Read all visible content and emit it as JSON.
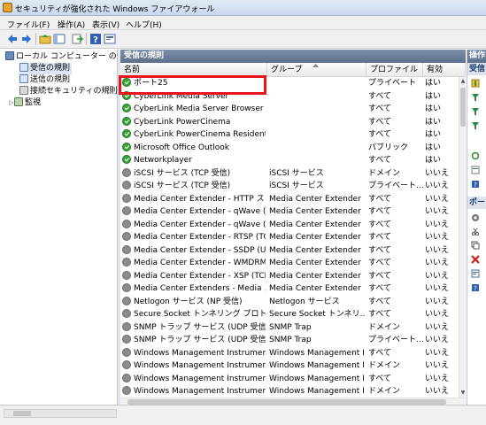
{
  "window": {
    "title": "セキュリティが強化された Windows ファイアウォール"
  },
  "menu": [
    "ファイル(F)",
    "操作(A)",
    "表示(V)",
    "ヘルプ(H)"
  ],
  "toolbar": {
    "icons": [
      "back-icon",
      "forward-icon",
      "up-folder-icon",
      "show-hide-tree-icon",
      "export-icon",
      "help-icon",
      "properties-icon"
    ]
  },
  "tree": {
    "root": "ローカル コンピューター のセ",
    "items": [
      "受信の規則",
      "送信の規則",
      "接続セキュリティの規則",
      "監視"
    ]
  },
  "main": {
    "title": "受信の規則",
    "columns": [
      "名前",
      "グループ",
      "プロファイル",
      "有効"
    ],
    "rows": [
      {
        "name": "ポート25",
        "group": "",
        "profile": "プライベート",
        "enabled": "はい",
        "status": "on"
      },
      {
        "name": "CyberLink Media Server",
        "group": "",
        "profile": "すべて",
        "enabled": "はい",
        "status": "on"
      },
      {
        "name": "CyberLink Media Server Browser Eng...",
        "group": "",
        "profile": "すべて",
        "enabled": "はい",
        "status": "on"
      },
      {
        "name": "CyberLink PowerCinema",
        "group": "",
        "profile": "すべて",
        "enabled": "はい",
        "status": "on"
      },
      {
        "name": "CyberLink PowerCinema Resident Pr...",
        "group": "",
        "profile": "すべて",
        "enabled": "はい",
        "status": "on"
      },
      {
        "name": "Microsoft Office Outlook",
        "group": "",
        "profile": "パブリック",
        "enabled": "はい",
        "status": "on"
      },
      {
        "name": "Networkplayer",
        "group": "",
        "profile": "すべて",
        "enabled": "はい",
        "status": "on"
      },
      {
        "name": "iSCSI サービス (TCP 受信)",
        "group": "iSCSI サービス",
        "profile": "ドメイン",
        "enabled": "いいえ",
        "status": "off"
      },
      {
        "name": "iSCSI サービス (TCP 受信)",
        "group": "iSCSI サービス",
        "profile": "プライベート...",
        "enabled": "いいえ",
        "status": "off"
      },
      {
        "name": "Media Center Extender - HTTP スト...",
        "group": "Media Center Extender",
        "profile": "すべて",
        "enabled": "いいえ",
        "status": "off"
      },
      {
        "name": "Media Center Extender - qWave (TC...",
        "group": "Media Center Extender",
        "profile": "すべて",
        "enabled": "いいえ",
        "status": "off"
      },
      {
        "name": "Media Center Extender - qWave (UD...",
        "group": "Media Center Extender",
        "profile": "すべて",
        "enabled": "いいえ",
        "status": "off"
      },
      {
        "name": "Media Center Extender - RTSP (TCP ...",
        "group": "Media Center Extender",
        "profile": "すべて",
        "enabled": "いいえ",
        "status": "off"
      },
      {
        "name": "Media Center Extender - SSDP (UDP...",
        "group": "Media Center Extender",
        "profile": "すべて",
        "enabled": "いいえ",
        "status": "off"
      },
      {
        "name": "Media Center Extender - WMDRM-N...",
        "group": "Media Center Extender",
        "profile": "すべて",
        "enabled": "いいえ",
        "status": "off"
      },
      {
        "name": "Media Center Extender - XSP (TCP ...",
        "group": "Media Center Extender",
        "profile": "すべて",
        "enabled": "いいえ",
        "status": "off"
      },
      {
        "name": "Media Center Extenders - Media スト...",
        "group": "Media Center Extender",
        "profile": "すべて",
        "enabled": "いいえ",
        "status": "off"
      },
      {
        "name": "Netlogon サービス (NP 受信)",
        "group": "Netlogon サービス",
        "profile": "すべて",
        "enabled": "いいえ",
        "status": "off"
      },
      {
        "name": "Secure Socket トンネリング プロトコ...",
        "group": "Secure Socket トンネリ...",
        "profile": "すべて",
        "enabled": "いいえ",
        "status": "off"
      },
      {
        "name": "SNMP トラップ サービス (UDP 受信)",
        "group": "SNMP Trap",
        "profile": "ドメイン",
        "enabled": "いいえ",
        "status": "off"
      },
      {
        "name": "SNMP トラップ サービス (UDP 受信)",
        "group": "SNMP Trap",
        "profile": "プライベート...",
        "enabled": "いいえ",
        "status": "off"
      },
      {
        "name": "Windows Management Instrumentat...",
        "group": "Windows Management I...",
        "profile": "すべて",
        "enabled": "いいえ",
        "status": "off"
      },
      {
        "name": "Windows Management Instrumentat...",
        "group": "Windows Management I...",
        "profile": "ドメイン",
        "enabled": "いいえ",
        "status": "off"
      },
      {
        "name": "Windows Management Instrumentat...",
        "group": "Windows Management I...",
        "profile": "すべて",
        "enabled": "いいえ",
        "status": "off"
      },
      {
        "name": "Windows Management Instrumentat...",
        "group": "Windows Management I...",
        "profile": "ドメイン",
        "enabled": "いいえ",
        "status": "off"
      }
    ]
  },
  "actions": {
    "title": "操作",
    "subtitle": "受信",
    "section2": "ポー"
  },
  "colors": {
    "highlight": "#e8151b",
    "section_header": "#6a7d97",
    "enabled_green": "#3aa43a",
    "disabled_gray": "#8c8c8c"
  }
}
